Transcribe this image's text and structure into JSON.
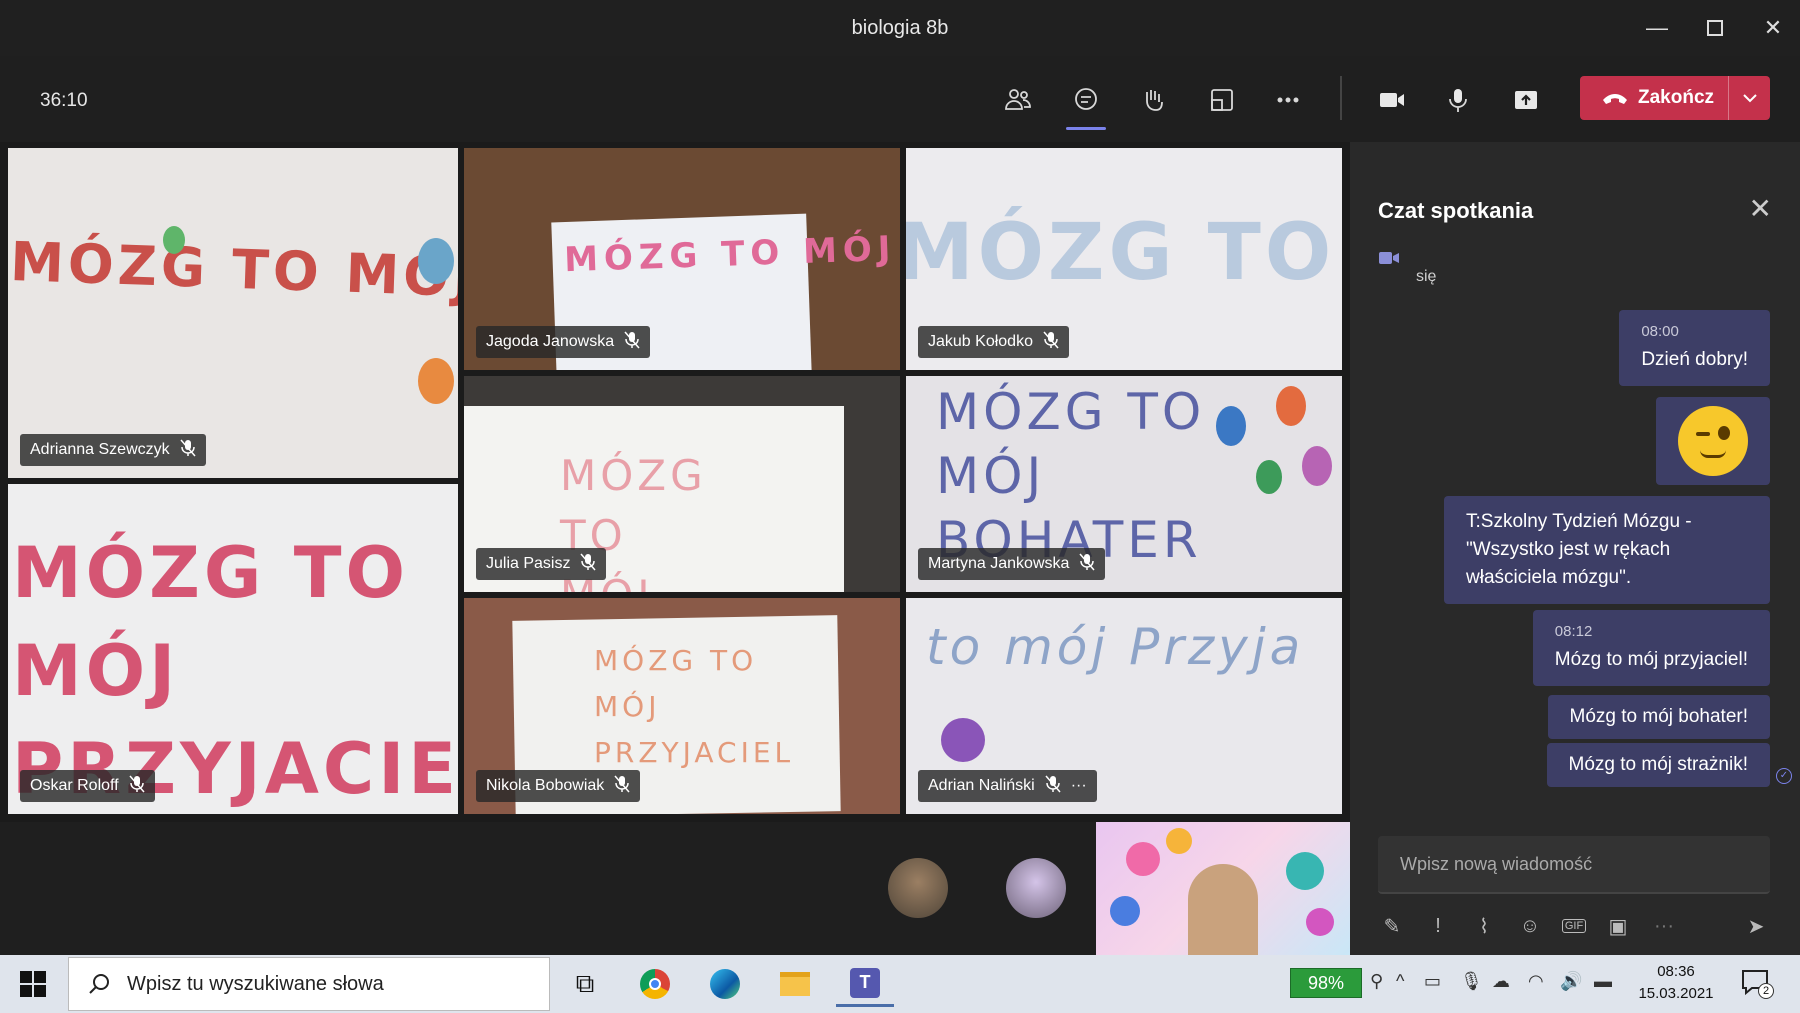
{
  "window": {
    "title": "biologia 8b"
  },
  "toolbar": {
    "timer": "36:10",
    "end_label": "Zakończ"
  },
  "participants": [
    {
      "name": "Adrianna Szewczyk",
      "sign": "MÓZG TO MÓJ BOHATER"
    },
    {
      "name": "Jagoda Janowska",
      "sign": "MÓZG TO MÓJ STRAŻNIK"
    },
    {
      "name": "Jakub Kołodko",
      "sign": "MÓZG TO MÓJ PRZYJACIEL"
    },
    {
      "name": "Oskar Roloff",
      "sign": "MÓZG TO MÓJ PRZYJACIEL"
    },
    {
      "name": "Julia Pasisz",
      "sign": "MÓZG TO MÓJ"
    },
    {
      "name": "Martyna Jankowska",
      "sign": "MÓZG TO MÓJ BOHATER"
    },
    {
      "name": "Nikola Bobowiak",
      "sign": "MÓZG TO MÓJ PRZYJACIEL"
    },
    {
      "name": "Adrian Naliński",
      "sign": "to mój Przyja"
    }
  ],
  "chat": {
    "title": "Czat spotkania",
    "system_msg": "się",
    "messages": [
      {
        "time": "08:00",
        "text": "Dzień dobry!"
      },
      {
        "text": "T:Szkolny Tydzień Mózgu - \"Wszystko jest w rękach właściciela mózgu\"."
      },
      {
        "time": "08:12",
        "text": "Mózg to mój przyjaciel!"
      },
      {
        "text": "Mózg to mój bohater!"
      },
      {
        "text": "Mózg to mój strażnik!"
      }
    ],
    "compose_placeholder": "Wpisz nową wiadomość"
  },
  "taskbar": {
    "search_placeholder": "Wpisz tu wyszukiwane słowa",
    "battery": "98%",
    "time": "08:36",
    "date": "15.03.2021",
    "notifications": "2"
  },
  "colors": {
    "end_call": "#c4314b",
    "chat_bubble": "#3d3e66",
    "accent": "#7b83eb"
  }
}
